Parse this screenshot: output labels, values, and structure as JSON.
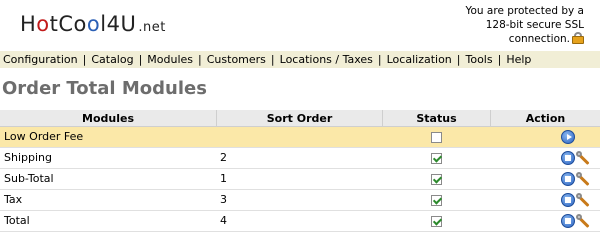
{
  "header": {
    "logo": {
      "hot": "H",
      "o1": "o",
      "t": "tCo",
      "o2": "o",
      "l": "l",
      "num": "4U",
      "net": ".net"
    },
    "ssl": {
      "line1": "You are protected by a",
      "line2": "128-bit secure SSL",
      "line3": "connection."
    }
  },
  "menu": {
    "items": [
      "Configuration",
      "Catalog",
      "Modules",
      "Customers",
      "Locations / Taxes",
      "Localization",
      "Tools",
      "Help"
    ]
  },
  "page": {
    "title": "Order Total Modules"
  },
  "table": {
    "headers": [
      "Modules",
      "Sort Order",
      "Status",
      "Action"
    ],
    "rows": [
      {
        "module": "Low Order Fee",
        "sort_order": "",
        "status": "unchecked",
        "action": "info"
      },
      {
        "module": "Shipping",
        "sort_order": "2",
        "status": "checked",
        "action": "edit"
      },
      {
        "module": "Sub-Total",
        "sort_order": "1",
        "status": "checked",
        "action": "edit"
      },
      {
        "module": "Tax",
        "sort_order": "3",
        "status": "checked",
        "action": "edit"
      },
      {
        "module": "Total",
        "sort_order": "4",
        "status": "checked",
        "action": "edit"
      }
    ]
  },
  "colors": {
    "menu_bg": "#f1eed6",
    "highlight_row": "#fbe8a8",
    "title": "#6d6d6d",
    "check": "#2c8a2c",
    "action_blue": "#2c64c2"
  }
}
